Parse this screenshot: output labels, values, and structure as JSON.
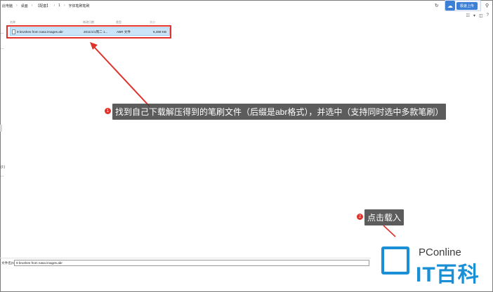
{
  "breadcrumb": [
    "此电脑",
    "桌面",
    "【配套】",
    "1",
    "字体笔刷笔刷"
  ],
  "topbar": {
    "refresh_glyph": "↻",
    "cloud_glyph": "☁",
    "upload_label": "极速上传",
    "search_glyph": "⚲"
  },
  "viewbar": {
    "view_glyph": "☷",
    "dropdown_glyph": "▾",
    "details_glyph": "◫",
    "help_glyph": "?"
  },
  "columns": [
    "名称",
    "修改日期",
    "类型",
    "大小"
  ],
  "file": {
    "name": "9 brushes from nasa images.abr",
    "modified": "2011/1/1周二 1...",
    "type": "ABR 文件",
    "size": "6,488 KB"
  },
  "left_marks": [
    "...",
    "...",
    "(I:)",
    "..."
  ],
  "callouts": [
    {
      "badge": "1",
      "text": "找到自己下载解压得到的笔刷文件（后缀是abr格式），并选中（支持同时选中多款笔刷）"
    },
    {
      "badge": "2",
      "text": "点击载入"
    }
  ],
  "filename_bar": {
    "label": "文件名(N):",
    "value": "9 brushes from nasa images.abr"
  },
  "watermark": {
    "pconline": "PConline",
    "itbaike": "IT百科"
  },
  "colors": {
    "accent": "#e0312a",
    "selection": "#cce4f7",
    "brand": "#1a8fd6"
  }
}
